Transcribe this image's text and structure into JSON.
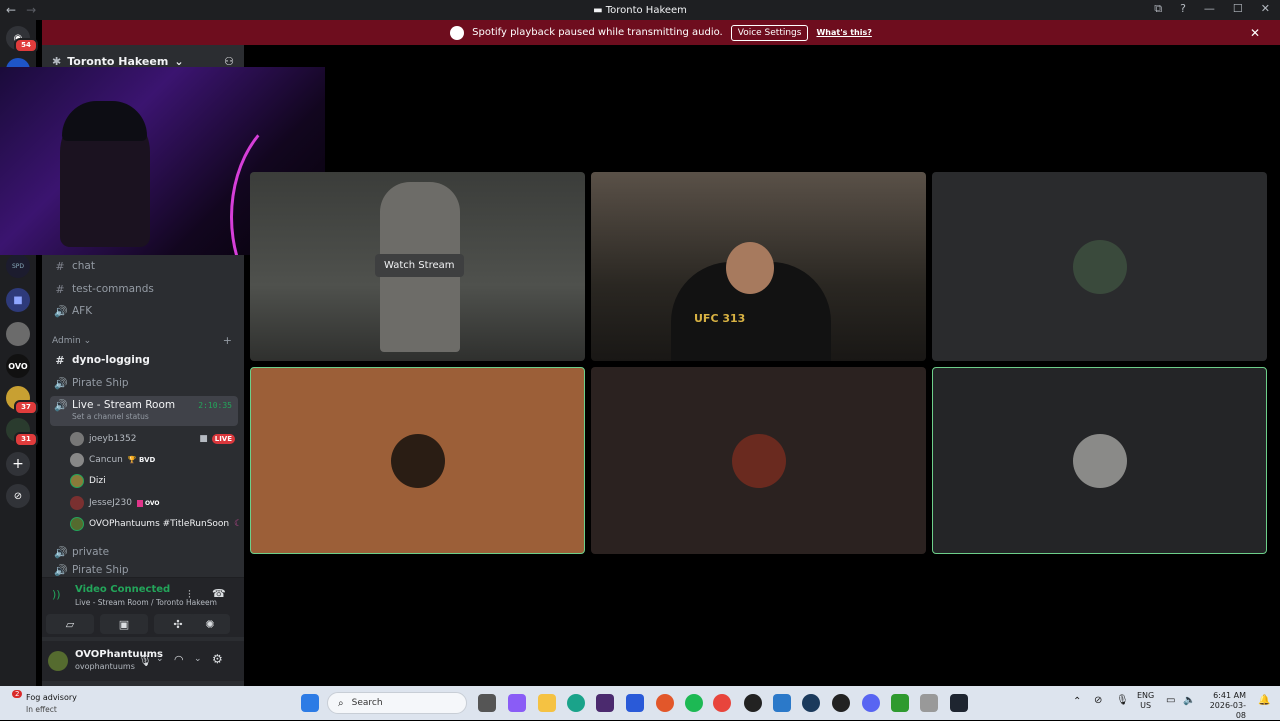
{
  "window": {
    "title": "Toronto Hakeem",
    "back_label": "←",
    "forward_label": "→",
    "controls": [
      "⧉",
      "?",
      "—",
      "☐",
      "✕"
    ]
  },
  "banner": {
    "message": "Spotify playback paused while transmitting audio.",
    "button": "Voice Settings",
    "link": "What's this?",
    "close": "✕"
  },
  "rail": {
    "home_badge": "54",
    "server_badges": [
      "37",
      "31"
    ]
  },
  "sidebar": {
    "guild_name": "Toronto Hakeem",
    "channels_top": [
      {
        "label": "chat",
        "icon": "#"
      },
      {
        "label": "test-commands",
        "icon": "#"
      },
      {
        "label": "AFK",
        "icon": "🔊"
      }
    ],
    "category": "Admin",
    "channels_admin": [
      {
        "label": "dyno-logging",
        "icon": "#"
      },
      {
        "label": "Pirate Ship",
        "icon": "🔊"
      }
    ],
    "voice_channel": {
      "label": "Live - Stream Room",
      "timer": "2:10:35",
      "status_placeholder": "Set a channel status"
    },
    "members": [
      {
        "name": "joeyb1352",
        "tag": "LIVE"
      },
      {
        "name": "Cancun",
        "tag": "🏆 BVD"
      },
      {
        "name": "Dizi",
        "tag": ""
      },
      {
        "name": "JesseJ230",
        "tag": "OVO"
      },
      {
        "name": "OVOPhantuums #TitleRunSoon",
        "tag": "☾"
      }
    ],
    "channels_bottom": [
      {
        "label": "private",
        "icon": "🔊"
      },
      {
        "label": "Pirate Ship",
        "icon": "🔊"
      }
    ]
  },
  "voice": {
    "status": "Video Connected",
    "location": "Live - Stream Room / Toronto Hakeem"
  },
  "user": {
    "display_name": "OVOPhantuums",
    "username": "ovophantuums"
  },
  "stage": {
    "watch_stream": "Watch Stream",
    "shirt_text": "UFC 313"
  },
  "taskbar": {
    "weather_badge": "2",
    "weather_title": "Fog advisory",
    "weather_sub": "In effect",
    "search_placeholder": "Search",
    "lang": "ENG",
    "region": "US",
    "time": "6:41 AM",
    "date": "2026-03-08"
  }
}
